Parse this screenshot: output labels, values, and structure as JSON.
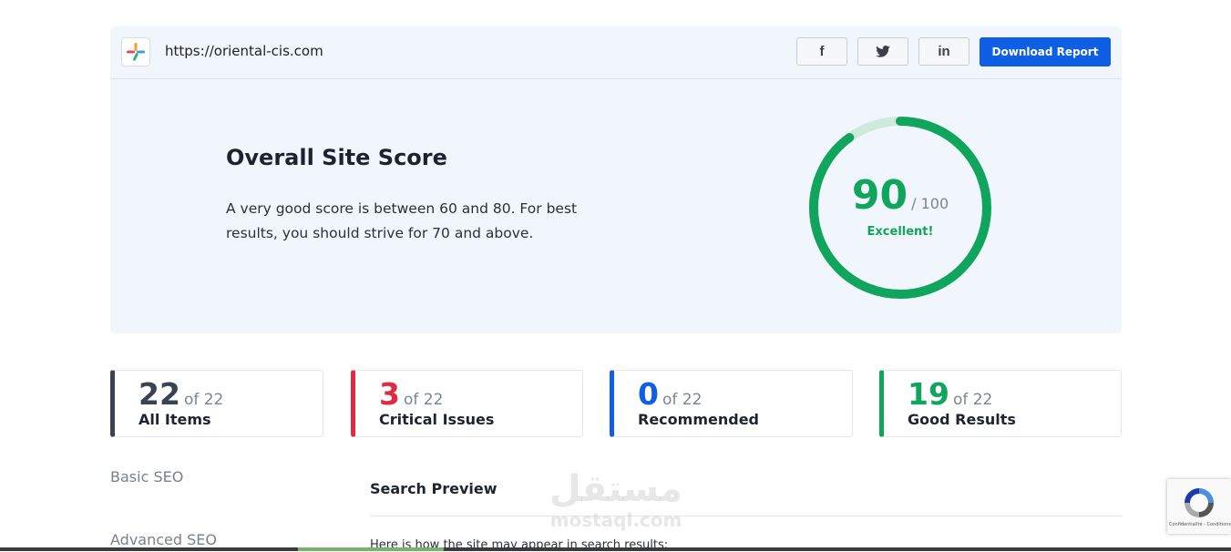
{
  "header": {
    "url": "https://oriental-cis.com",
    "share_buttons": [
      {
        "name": "facebook",
        "label": "f"
      },
      {
        "name": "twitter",
        "label": "twitter-bird"
      },
      {
        "name": "linkedin",
        "label": "in"
      }
    ],
    "download_label": "Download Report"
  },
  "score": {
    "title": "Overall Site Score",
    "description": "A very good score is between 60 and 80. For best results, you should strive for 70 and above.",
    "value": "90",
    "max": "/ 100",
    "rating": "Excellent!",
    "fraction": 0.9,
    "color": "#0fa55c"
  },
  "stats": [
    {
      "count": "22",
      "of": "of 22",
      "label": "All Items",
      "color": "#3b4252"
    },
    {
      "count": "3",
      "of": "of 22",
      "label": "Critical Issues",
      "color": "#dc2b43"
    },
    {
      "count": "0",
      "of": "of 22",
      "label": "Recommended",
      "color": "#0f5ee6"
    },
    {
      "count": "19",
      "of": "of 22",
      "label": "Good Results",
      "color": "#0fa55c"
    }
  ],
  "sidebar": {
    "items": [
      {
        "label": "Basic SEO"
      },
      {
        "label": "Advanced SEO"
      }
    ]
  },
  "section": {
    "title": "Search Preview",
    "text": "Here is how the site may appear in search results:"
  },
  "watermark": {
    "arabic": "مستقل",
    "latin": "mostaql.com"
  },
  "recaptcha": {
    "text": "Confidentialité - Conditions"
  }
}
